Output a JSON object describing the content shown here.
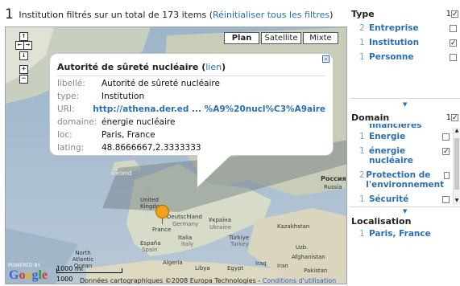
{
  "summary": {
    "count": "1",
    "text": "Institution filtrés sur un total de 173 items",
    "reset_open": "(",
    "reset_label": "Réinitialiser tous les filtres",
    "reset_close": ")"
  },
  "map": {
    "maptypes": [
      "Plan",
      "Satellite",
      "Mixte"
    ],
    "active_maptype": "Plan",
    "nav": {
      "up": "↑",
      "left": "←",
      "right": "→",
      "down": "↓",
      "zoom_in": "+",
      "zoom_out": "−"
    },
    "popup": {
      "title": "Autorité de sûreté nucléaire",
      "link_label": "lien",
      "rows": [
        {
          "key": "libellé:",
          "value": "Autorité de sûreté nucléaire"
        },
        {
          "key": "type:",
          "value": "Institution"
        },
        {
          "key": "URI:",
          "value": "http://athena.der.ed ... %A9%20nucl%C3%A9aire"
        },
        {
          "key": "domaine:",
          "value": "énergie nucléaire"
        },
        {
          "key": "loc:",
          "value": "Paris, France"
        },
        {
          "key": "latlng:",
          "value": "48.8666667,2.3333333"
        }
      ]
    },
    "labels": {
      "iceland": "Iceland",
      "russia": "Россия",
      "russia_en": "Russia",
      "united_kingdom": "United Kingdom",
      "deutschland": "Deutschland",
      "germany": "Germany",
      "ukraina": "Україна",
      "ukraine": "Ukraine",
      "kazakhstan": "Kazakhstan",
      "france": "France",
      "italia": "Italia",
      "italy": "Italy",
      "turkiye": "Türkiye",
      "turkey": "Turkey",
      "espana": "España",
      "spain": "Spain",
      "north_atlantic": "North Atlantic Ocean",
      "algeria": "Algeria",
      "libya": "Libya",
      "egypt": "Egypt",
      "iraq": "Iraq",
      "iran": "Iran",
      "afghanistan": "Afghanistan",
      "pakistan": "Pakistan",
      "uzb": "Uzb."
    },
    "powered_by": "POWERED BY",
    "logo": "Google",
    "scale_mi": "1000 mi",
    "scale_km": "1000 km",
    "credit_text": "Données cartographiques ©2008 Europa Technologies - ",
    "credit_link": "Conditions d'utilisation"
  },
  "facets": {
    "type": {
      "title": "Type",
      "selected_count": "1",
      "items": [
        {
          "count": "2",
          "label": "Entreprise",
          "checked": false
        },
        {
          "count": "1",
          "label": "Institution",
          "checked": true
        },
        {
          "count": "1",
          "label": "Personne",
          "checked": false
        }
      ]
    },
    "domain": {
      "title": "Domain",
      "selected_count": "1",
      "items": [
        {
          "count": "",
          "label": "financières",
          "checked": null
        },
        {
          "count": "1",
          "label": "Energie",
          "checked": false
        },
        {
          "count": "1",
          "label": "énergie nucléaire",
          "checked": true
        },
        {
          "count": "2",
          "label": "Protection de l'environnement",
          "checked": false
        },
        {
          "count": "1",
          "label": "Sécurité",
          "checked": false
        }
      ]
    },
    "localisation": {
      "title": "Localisation",
      "items": [
        {
          "count": "1",
          "label": "Paris, France"
        }
      ]
    }
  },
  "colors": {
    "link": "#2a6fb5",
    "count_gray_blue": "#7ea0c8",
    "map_water": "#9db4c9",
    "marker": "#f0a21d"
  },
  "icons": {
    "popup_close": "close-icon",
    "checkmark": "✓",
    "sort_arrow": "▼"
  }
}
